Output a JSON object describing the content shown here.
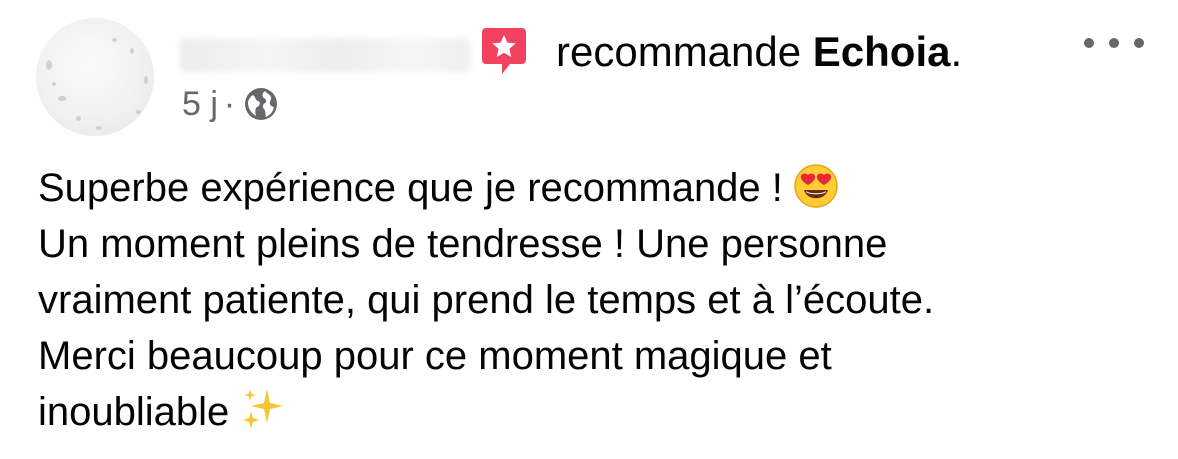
{
  "post": {
    "author_name": "",
    "action_text": "recommande",
    "page_name": "Echoia",
    "page_suffix": ".",
    "timestamp": "5 j",
    "separator": "·",
    "audience_icon": "globe-icon",
    "recommend_icon": "recommend-star-icon",
    "more_icon": "more-options-icon",
    "lines": [
      "Superbe expérience que je recommande !",
      "Un moment pleins de tendresse ! Une personne",
      "vraiment patiente, qui prend le temps et à l’écoute.",
      "Merci beaucoup pour ce moment magique et",
      "inoubliable"
    ],
    "line1_emoji": "heart-eyes-emoji",
    "line5_emoji": "sparkles-emoji"
  },
  "colors": {
    "text": "#050505",
    "secondary": "#65676b",
    "recommend_badge": "#f3425f"
  }
}
